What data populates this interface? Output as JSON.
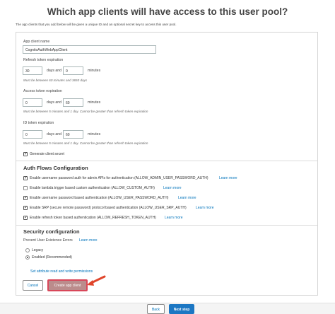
{
  "page": {
    "title": "Which app clients will have access to this user pool?",
    "intro": "The app clients that you add below will be given a unique ID and an optional secret key to access this user pool."
  },
  "app_client": {
    "name_label": "App client name",
    "name_value": "CognitoAuthWebAppClient"
  },
  "refresh_token": {
    "label": "Refresh token expiration",
    "days_value": "30",
    "days_text": "days and",
    "minutes_value": "0",
    "minutes_text": "minutes",
    "hint": "Must be between 60 minutes and 3650 days"
  },
  "access_token": {
    "label": "Access token expiration",
    "days_value": "0",
    "days_text": "days and",
    "minutes_value": "60",
    "minutes_text": "minutes",
    "hint": "Must be between 5 minutes and 1 day. Cannot be greater than refresh token expiration"
  },
  "id_token": {
    "label": "ID token expiration",
    "days_value": "0",
    "days_text": "days and",
    "minutes_value": "60",
    "minutes_text": "minutes",
    "hint": "Must be between 5 minutes and 1 day. Cannot be greater than refresh token expiration"
  },
  "generate_secret": {
    "label": "Generate client secret",
    "checked": true
  },
  "auth_flows": {
    "title": "Auth Flows Configuration",
    "items": [
      {
        "label": "Enable username password auth for admin APIs for authentication (ALLOW_ADMIN_USER_PASSWORD_AUTH)",
        "checked": true,
        "link": "Learn more"
      },
      {
        "label": "Enable lambda trigger based custom authentication (ALLOW_CUSTOM_AUTH)",
        "checked": false,
        "link": "Learn more"
      },
      {
        "label": "Enable username password based authentication (ALLOW_USER_PASSWORD_AUTH)",
        "checked": true,
        "link": "Learn more"
      },
      {
        "label": "Enable SRP (secure remote password) protocol based authentication (ALLOW_USER_SRP_AUTH)",
        "checked": true,
        "link": "Learn more"
      },
      {
        "label": "Enable refresh token based authentication (ALLOW_REFRESH_TOKEN_AUTH)",
        "checked": true,
        "link": "Learn more"
      }
    ]
  },
  "security": {
    "title": "Security configuration",
    "prevent_label": "Prevent User Existence Errors",
    "learn_more": "Learn more",
    "options": [
      {
        "label": "Legacy",
        "checked": false
      },
      {
        "label": "Enabled (Recommended)",
        "checked": true
      }
    ]
  },
  "attr_link": "Set attribute read and write permissions",
  "buttons": {
    "cancel": "Cancel",
    "create": "Create app client",
    "back": "Back",
    "next": "Next step"
  },
  "colors": {
    "link": "#0073bb",
    "primary": "#1c77c3",
    "highlight": "#d8475a",
    "arrow": "#e0452b"
  },
  "icons": {
    "pointer_arrow": "arrow-pointer-icon"
  }
}
